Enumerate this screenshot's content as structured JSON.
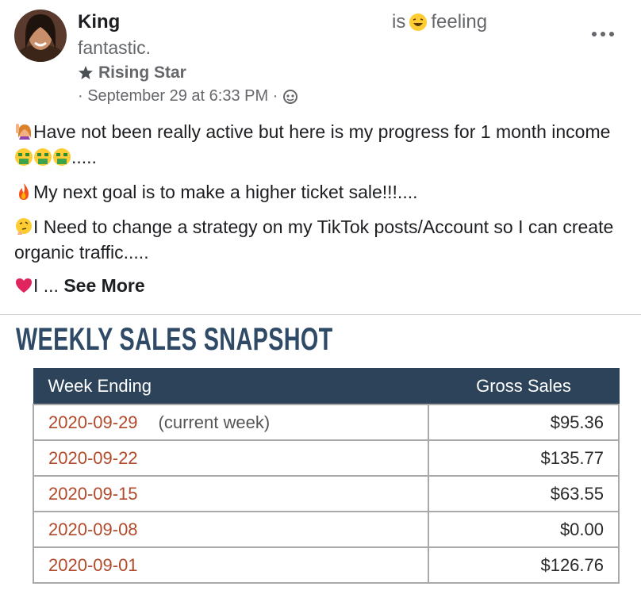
{
  "post": {
    "author": "King",
    "feeling_prefix": "is",
    "feeling_label": "feeling",
    "feeling_value": "fantastic.",
    "badge": "Rising Star",
    "timestamp": "· September 29 at 6:33 PM ·",
    "paragraphs": [
      {
        "emoji": "woman-raising-hand-icon",
        "text": "Have not been really active but here is my progress for 1 month income",
        "suffix": "....."
      },
      {
        "emoji": "fire-icon",
        "text": "My next goal is to make a higher ticket sale!!!...."
      },
      {
        "emoji": "thinking-face-icon",
        "text": "I Need to change a strategy on my TikTok posts/Account so I can create organic traffic....."
      },
      {
        "emoji": "red-heart-icon",
        "text": "I ...",
        "see_more": "See More"
      }
    ]
  },
  "snapshot": {
    "title": "WEEKLY SALES SNAPSHOT",
    "headers": [
      "Week Ending",
      "Gross Sales"
    ],
    "rows": [
      {
        "date": "2020-09-29",
        "note": "(current week)",
        "amount": "$95.36"
      },
      {
        "date": "2020-09-22",
        "note": "",
        "amount": "$135.77"
      },
      {
        "date": "2020-09-15",
        "note": "",
        "amount": "$63.55"
      },
      {
        "date": "2020-09-08",
        "note": "",
        "amount": "$0.00"
      },
      {
        "date": "2020-09-01",
        "note": "",
        "amount": "$126.76"
      }
    ],
    "header_color": "#2c4359",
    "date_color": "#b04a2a"
  }
}
